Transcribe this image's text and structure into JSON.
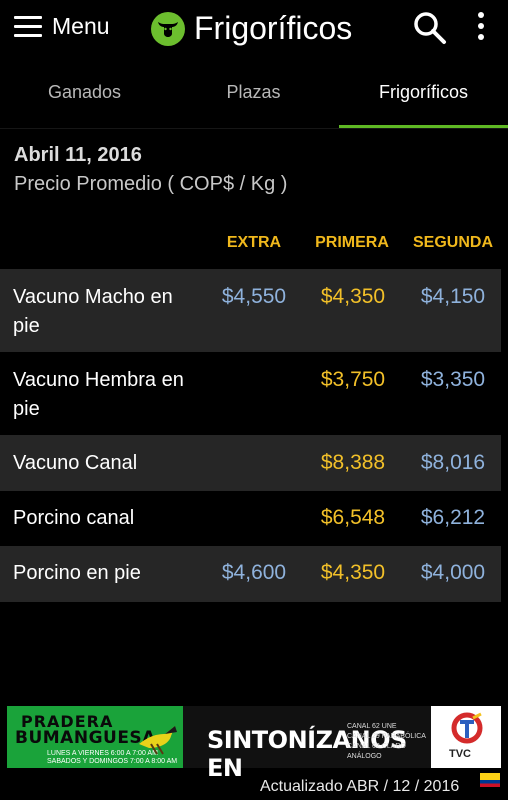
{
  "appbar": {
    "menu_label": "Menu",
    "title": "Frigoríficos",
    "icons": [
      "hamburger-icon",
      "bull-logo-icon",
      "search-icon",
      "more-vert-icon"
    ]
  },
  "tabs": [
    {
      "label": "Ganados",
      "active": false
    },
    {
      "label": "Plazas",
      "active": false
    },
    {
      "label": "Frigoríficos",
      "active": true
    }
  ],
  "header": {
    "date": "Abril 11, 2016",
    "subtitle": "Precio Promedio ( COP$ / Kg )"
  },
  "columns": [
    "EXTRA",
    "PRIMERA",
    "SEGUNDA"
  ],
  "rows": [
    {
      "name": "Vacuno Macho en pie",
      "extra": "$4,550",
      "primera": "$4,350",
      "segunda": "$4,150"
    },
    {
      "name": "Vacuno Hembra en pie",
      "extra": "",
      "primera": "$3,750",
      "segunda": "$3,350"
    },
    {
      "name": "Vacuno Canal",
      "extra": "",
      "primera": "$8,388",
      "segunda": "$8,016"
    },
    {
      "name": "Porcino canal",
      "extra": "",
      "primera": "$6,548",
      "segunda": "$6,212"
    },
    {
      "name": "Porcino en pie",
      "extra": "$4,600",
      "primera": "$4,350",
      "segunda": "$4,000"
    }
  ],
  "ad": {
    "left_line1": "PRADERA",
    "left_line2": "BUMANGUESA",
    "left_small1": "LUNES A VIERNES    6:00 A 7:00 AM",
    "left_small2": "SABADOS Y DOMINGOS  7:00 A 8:00 AM",
    "mid_big": "SINTONÍZANOS EN",
    "mid_small1": "CANAL 62 UNE",
    "mid_small2": "CANAL 29 PARABÓLICA",
    "mid_small3": "CANAL 62 CLARO ANÁLOGO",
    "right_label": "TVC"
  },
  "footer": {
    "updated": "Actualizado ABR / 12 / 2016",
    "flag_icon": "colombia-flag-icon",
    "colors": {
      "accent": "#5fb824",
      "gold": "#f2c029",
      "blue": "#8fb2dc"
    }
  }
}
